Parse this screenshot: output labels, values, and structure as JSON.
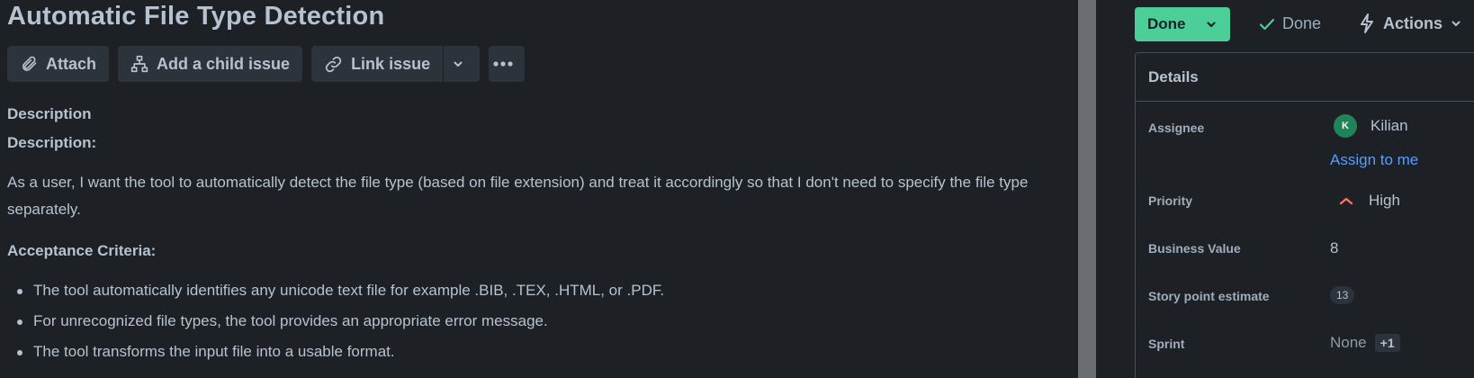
{
  "issue": {
    "title": "Automatic File Type Detection"
  },
  "toolbar": {
    "attach_label": "Attach",
    "child_issue_label": "Add a child issue",
    "link_issue_label": "Link issue"
  },
  "description": {
    "section_heading": "Description",
    "bold_heading": "Description:",
    "paragraph": "As a user, I want the tool to automatically detect the file type (based on file extension) and treat it accordingly so that I don't need to specify the file type separately.",
    "criteria_heading": "Acceptance Criteria:",
    "criteria": [
      "The tool automatically identifies any unicode text file for example .BIB, .TEX, .HTML, or .PDF.",
      "For unrecognized file types, the tool provides an appropriate error message.",
      "The tool transforms the input file into a usable format."
    ]
  },
  "status": {
    "button_label": "Done",
    "indicator_label": "Done",
    "actions_label": "Actions"
  },
  "details": {
    "title": "Details",
    "assignee_label": "Assignee",
    "assignee_initial": "K",
    "assignee_name": "Kilian",
    "assign_to_me": "Assign to me",
    "priority_label": "Priority",
    "priority_value": "High",
    "business_value_label": "Business Value",
    "business_value": "8",
    "story_points_label": "Story point estimate",
    "story_points": "13",
    "sprint_label": "Sprint",
    "sprint_value": "None",
    "sprint_extra": "+1"
  },
  "colors": {
    "background": "#1d2125",
    "button": "#2c333a",
    "status_green": "#4bce97",
    "link_blue": "#579dff",
    "priority_red": "#f87462"
  }
}
